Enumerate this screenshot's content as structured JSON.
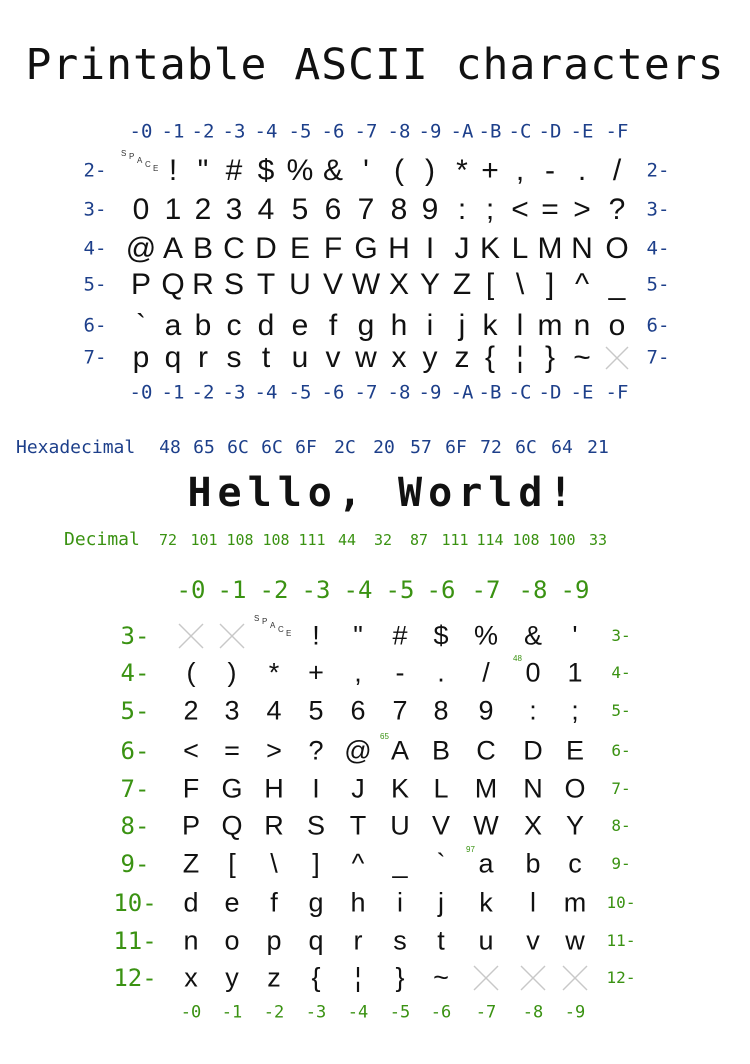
{
  "title": "Printable ASCII characters",
  "hex_table": {
    "col_labels": [
      "-0",
      "-1",
      "-2",
      "-3",
      "-4",
      "-5",
      "-6",
      "-7",
      "-8",
      "-9",
      "-A",
      "-B",
      "-C",
      "-D",
      "-E",
      "-F"
    ],
    "row_labels": [
      "2-",
      "3-",
      "4-",
      "5-",
      "6-",
      "7-"
    ],
    "rows": [
      [
        "SPACE",
        "!",
        "\"",
        "#",
        "$",
        "%",
        "&",
        "'",
        "(",
        ")",
        "*",
        "+",
        ",",
        "-",
        ".",
        "/"
      ],
      [
        "0",
        "1",
        "2",
        "3",
        "4",
        "5",
        "6",
        "7",
        "8",
        "9",
        ":",
        ";",
        "<",
        "=",
        ">",
        "?"
      ],
      [
        "@",
        "A",
        "B",
        "C",
        "D",
        "E",
        "F",
        "G",
        "H",
        "I",
        "J",
        "K",
        "L",
        "M",
        "N",
        "O"
      ],
      [
        "P",
        "Q",
        "R",
        "S",
        "T",
        "U",
        "V",
        "W",
        "X",
        "Y",
        "Z",
        "[",
        "\\",
        "]",
        "^",
        "_"
      ],
      [
        "`",
        "a",
        "b",
        "c",
        "d",
        "e",
        "f",
        "g",
        "h",
        "i",
        "j",
        "k",
        "l",
        "m",
        "n",
        "o"
      ],
      [
        "p",
        "q",
        "r",
        "s",
        "t",
        "u",
        "v",
        "w",
        "x",
        "y",
        "z",
        "{",
        "¦",
        "}",
        "~",
        null
      ]
    ]
  },
  "example": {
    "hex_label": "Hexadecimal",
    "hex_values": [
      "48",
      "65",
      "6C",
      "6C",
      "6F",
      "2C",
      "20",
      "57",
      "6F",
      "72",
      "6C",
      "64",
      "21"
    ],
    "text": "Hello, World!",
    "dec_label": "Decimal",
    "dec_values": [
      "72",
      "101",
      "108",
      "108",
      "111",
      "44",
      "32",
      "87",
      "111",
      "114",
      "108",
      "100",
      "33"
    ]
  },
  "dec_table": {
    "col_labels": [
      "-0",
      "-1",
      "-2",
      "-3",
      "-4",
      "-5",
      "-6",
      "-7",
      "-8",
      "-9"
    ],
    "row_labels": [
      "3-",
      "4-",
      "5-",
      "6-",
      "7-",
      "8-",
      "9-",
      "10-",
      "11-",
      "12-"
    ],
    "rows": [
      [
        null,
        null,
        "SPACE",
        "!",
        "\"",
        "#",
        "$",
        "%",
        "&",
        "'"
      ],
      [
        "(",
        ")",
        "*",
        "+",
        ",",
        "-",
        ".",
        "/",
        "0",
        "1"
      ],
      [
        "2",
        "3",
        "4",
        "5",
        "6",
        "7",
        "8",
        "9",
        ":",
        ";"
      ],
      [
        "<",
        "=",
        ">",
        "?",
        "@",
        "A",
        "B",
        "C",
        "D",
        "E"
      ],
      [
        "F",
        "G",
        "H",
        "I",
        "J",
        "K",
        "L",
        "M",
        "N",
        "O"
      ],
      [
        "P",
        "Q",
        "R",
        "S",
        "T",
        "U",
        "V",
        "W",
        "X",
        "Y"
      ],
      [
        "Z",
        "[",
        "\\",
        "]",
        "^",
        "_",
        "`",
        "a",
        "b",
        "c"
      ],
      [
        "d",
        "e",
        "f",
        "g",
        "h",
        "i",
        "j",
        "k",
        "l",
        "m"
      ],
      [
        "n",
        "o",
        "p",
        "q",
        "r",
        "s",
        "t",
        "u",
        "v",
        "w"
      ],
      [
        "x",
        "y",
        "z",
        "{",
        "¦",
        "}",
        "~",
        null,
        null,
        null
      ]
    ],
    "markers": [
      {
        "row": 1,
        "col": 8,
        "text": "48"
      },
      {
        "row": 3,
        "col": 5,
        "text": "65"
      },
      {
        "row": 6,
        "col": 7,
        "text": "97"
      }
    ]
  },
  "colors": {
    "hex": "#1d3f8a",
    "dec": "#3a9212",
    "text": "#111111",
    "gap": "#c8c8c8"
  }
}
